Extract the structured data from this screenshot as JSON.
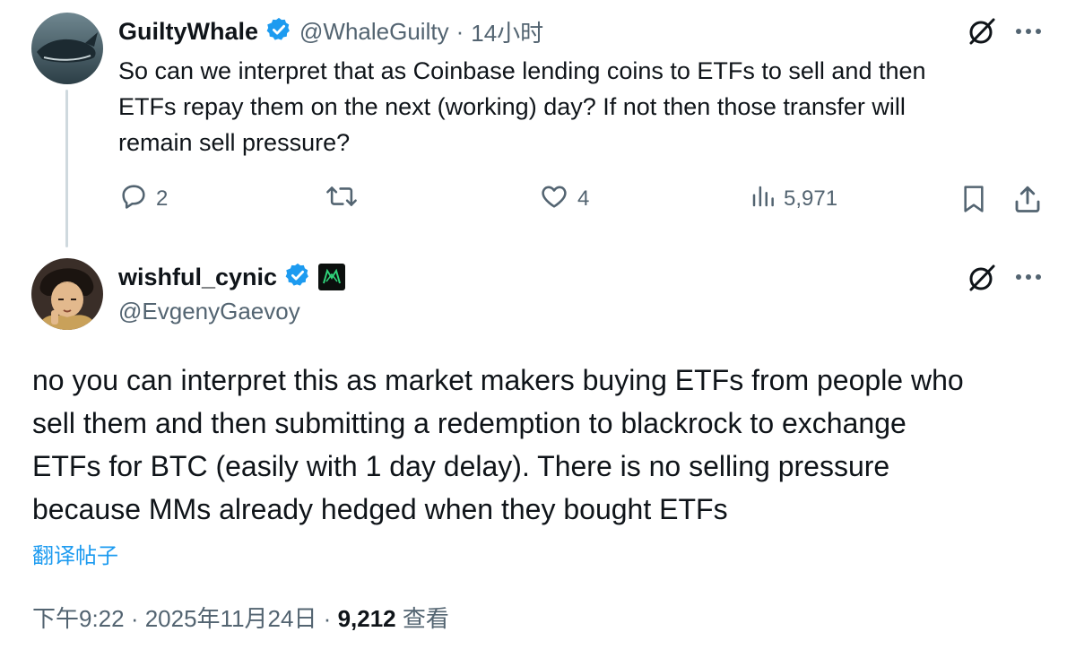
{
  "reply": {
    "author_name": "GuiltyWhale",
    "author_handle": "@WhaleGuilty",
    "time": "14小时",
    "text_lines": [
      "So can we interpret that as Coinbase lending coins to ETFs to sell and then",
      "ETFs repay them on the next (working) day? If not then those transfer will",
      "remain sell pressure?"
    ],
    "actions": {
      "replies": "2",
      "retweets": "",
      "likes": "4",
      "views": "5,971"
    }
  },
  "main": {
    "author_name": "wishful_cynic",
    "author_handle": "@EvgenyGaevoy",
    "text_lines": [
      "no you can interpret this as market makers buying ETFs from people who",
      "sell them and then submitting a redemption to blackrock to exchange",
      "ETFs for BTC (easily with 1 day delay). There is no selling pressure",
      "because MMs already hedged when they bought ETFs"
    ],
    "translate_label": "翻译帖子",
    "timestamp": "下午9:22 · 2025年11月24日 · ",
    "views_count": "9,212",
    "views_label": " 查看"
  },
  "colors": {
    "accent": "#1d9bf0",
    "text": "#0f1419",
    "muted": "#536471"
  },
  "icons": [
    "verified-badge-icon",
    "grok-icon",
    "more-icon",
    "reply-icon",
    "retweet-icon",
    "like-icon",
    "views-icon",
    "bookmark-icon",
    "share-icon",
    "affiliate-badge-icon"
  ]
}
